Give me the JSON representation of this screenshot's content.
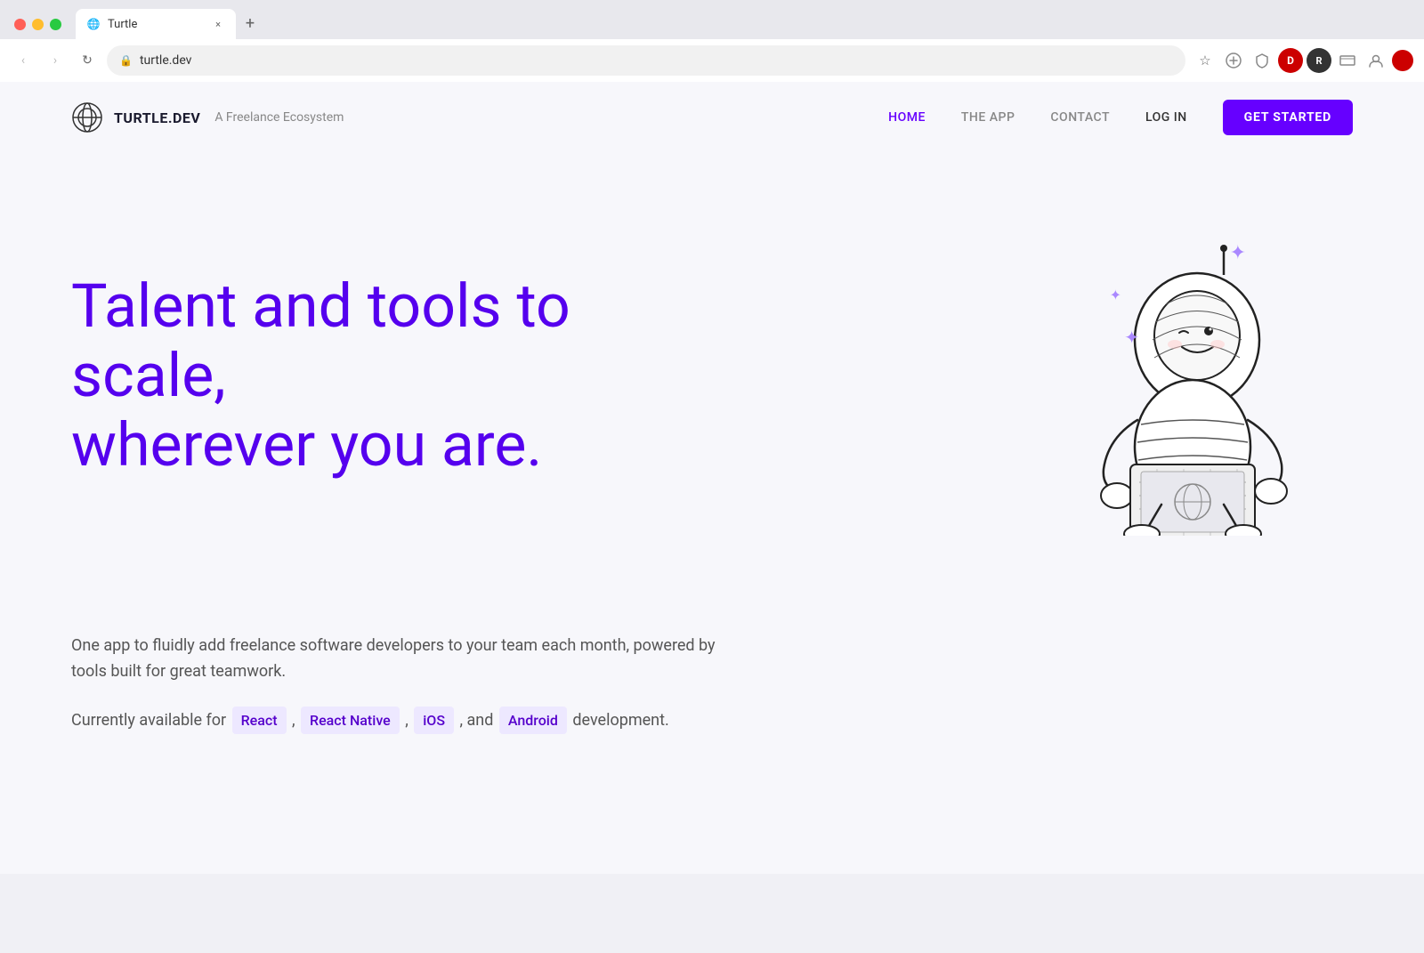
{
  "browser": {
    "tab_title": "Turtle",
    "tab_favicon": "🌐",
    "new_tab_label": "+",
    "close_label": "×",
    "nav_back": "‹",
    "nav_forward": "›",
    "nav_reload": "↻",
    "address_url": "turtle.dev",
    "lock_icon": "🔒",
    "toolbar_icons": [
      "☆",
      "🔍",
      "🛡",
      "D",
      "R",
      "📺",
      "👤",
      "🔴"
    ]
  },
  "nav": {
    "brand_name": "TURTLE.DEV",
    "brand_tagline": "A Freelance Ecosystem",
    "links": [
      {
        "label": "HOME",
        "active": true
      },
      {
        "label": "THE APP",
        "active": false
      },
      {
        "label": "CONTACT",
        "active": false
      }
    ],
    "login_label": "LOG IN",
    "cta_label": "GET STARTED"
  },
  "hero": {
    "title_line1": "Talent and tools to scale,",
    "title_line2": "wherever you are."
  },
  "description": {
    "paragraph": "One app to fluidly add freelance software developers to your team each month, powered by tools built for great teamwork.",
    "tech_intro": "Currently available for",
    "tech_items": [
      "React",
      "React Native",
      "iOS",
      "Android"
    ],
    "tech_suffix": "development.",
    "tech_separator_and": "and"
  },
  "colors": {
    "primary": "#6600ff",
    "primary_text": "#5500ee",
    "badge_bg": "#ede8ff",
    "badge_text": "#5500cc",
    "nav_bg": "#f7f7fb"
  }
}
